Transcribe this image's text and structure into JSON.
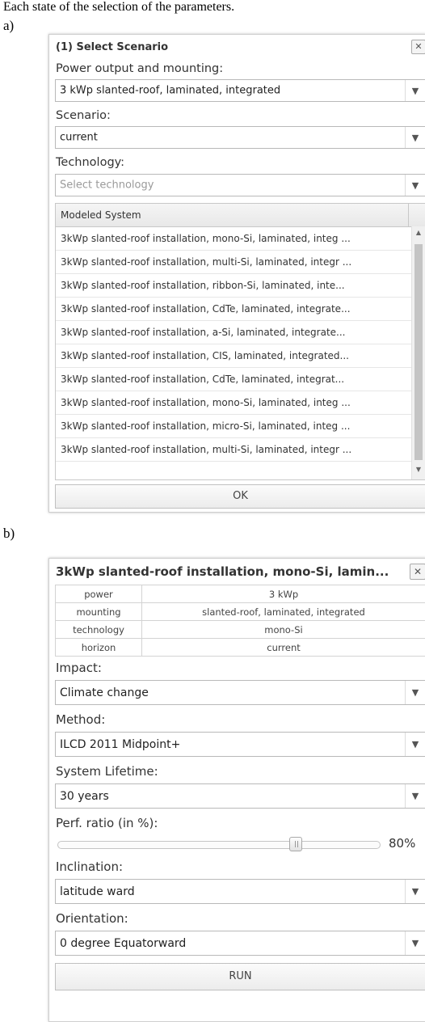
{
  "caption": "Each state of the selection of the parameters.",
  "figure_labels": {
    "a": "a)",
    "b": "b)"
  },
  "dialog_a": {
    "title": "(1) Select Scenario",
    "close_glyph": "✕",
    "power_label": "Power output and mounting:",
    "power_value": "3 kWp slanted-roof, laminated, integrated",
    "scenario_label": "Scenario:",
    "scenario_value": "current",
    "technology_label": "Technology:",
    "technology_placeholder": "Select technology",
    "grid_header": "Modeled System",
    "rows": [
      "3kWp slanted-roof installation, mono-Si, laminated, integ ...",
      "3kWp slanted-roof installation, multi-Si, laminated, integr ...",
      "3kWp slanted-roof installation, ribbon-Si, laminated, inte...",
      "3kWp slanted-roof installation, CdTe, laminated, integrate...",
      "3kWp slanted-roof installation, a-Si, laminated, integrate...",
      "3kWp slanted-roof installation, CIS, laminated, integrated...",
      "3kWp slanted-roof installation, CdTe, laminated, integrat...",
      "3kWp slanted-roof installation, mono-Si, laminated, integ ...",
      "3kWp slanted-roof installation, micro-Si, laminated, integ ...",
      "3kWp slanted-roof installation, multi-Si, laminated, integr ..."
    ],
    "ok_label": "OK"
  },
  "dialog_b": {
    "title": "3kWp slanted-roof installation, mono-Si, lamin...",
    "close_glyph": "✕",
    "info": [
      {
        "key": "power",
        "value": "3 kWp"
      },
      {
        "key": "mounting",
        "value": "slanted-roof, laminated, integrated"
      },
      {
        "key": "technology",
        "value": "mono-Si"
      },
      {
        "key": "horizon",
        "value": "current"
      }
    ],
    "impact_label": "Impact:",
    "impact_value": "Climate change",
    "method_label": "Method:",
    "method_value": "ILCD 2011 Midpoint+",
    "lifetime_label": "System Lifetime:",
    "lifetime_value": "30 years",
    "perf_label": "Perf. ratio (in %):",
    "perf_value": "80%",
    "perf_fraction": 0.8,
    "inclination_label": "Inclination:",
    "inclination_value": "latitude ward",
    "orientation_label": "Orientation:",
    "orientation_value": "0 degree Equatorward",
    "run_label": "RUN"
  },
  "icons": {
    "dropdown": "chevron-down-icon",
    "close": "close-icon"
  },
  "colors": {
    "border": "#b9b9b9",
    "header_bg": "#ececec",
    "scroll_thumb": "#c4c4c4"
  }
}
